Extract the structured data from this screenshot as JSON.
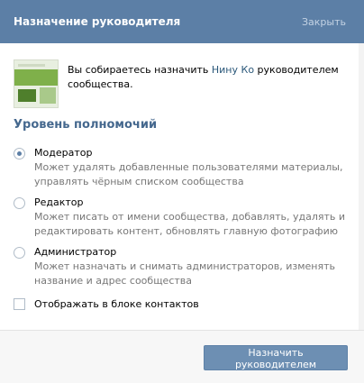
{
  "dialog": {
    "title": "Назначение руководителя",
    "close_label": "Закрыть"
  },
  "intro": {
    "text_before": "Вы собираетесь назначить ",
    "user_name": "Нину Ко",
    "text_after": " руководителем сообщества."
  },
  "permissions": {
    "title": "Уровень полномочий",
    "options": [
      {
        "label": "Модератор",
        "description": "Может удалять добавленные пользователями материалы, управлять чёрным списком сообщества",
        "selected": true
      },
      {
        "label": "Редактор",
        "description": "Может писать от имени сообщества, добавлять, удалять и редактировать контент, обновлять главную фотографию",
        "selected": false
      },
      {
        "label": "Администратор",
        "description": "Может назначать и снимать администраторов, изменять название и адрес сообщества",
        "selected": false
      }
    ]
  },
  "contacts_checkbox": {
    "label": "Отображать в блоке контактов",
    "checked": false
  },
  "footer": {
    "submit_label": "Назначить руководителем"
  },
  "colors": {
    "header": "#5c7fa6",
    "accent": "#45688e",
    "button": "#6d8fb3"
  }
}
